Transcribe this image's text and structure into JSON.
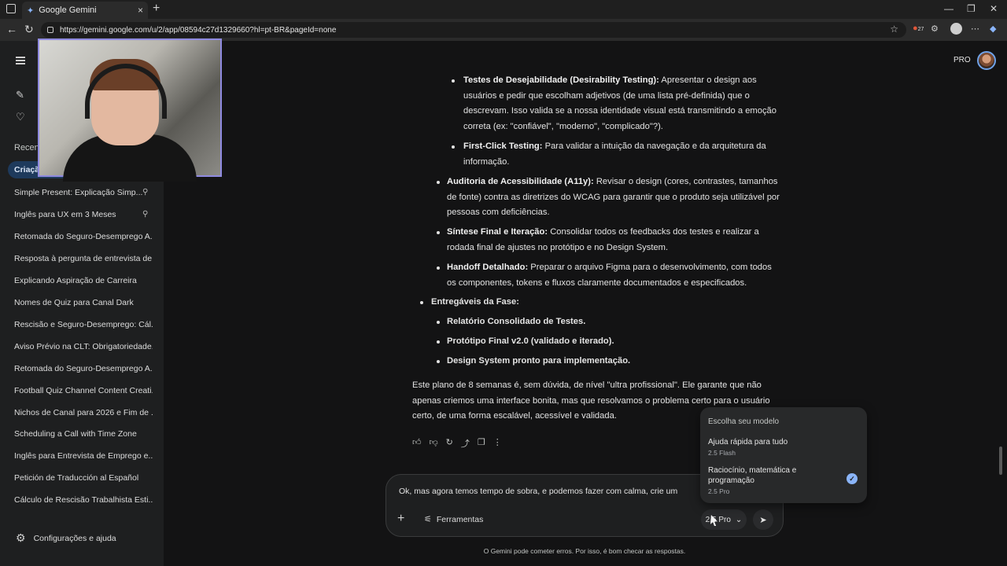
{
  "browser": {
    "tab_title": "Google Gemini",
    "url": "https://gemini.google.com/u/2/app/08594c27d1329660?hl=pt-BR&pageId=none",
    "ext_badge": "27"
  },
  "sidebar": {
    "recent_heading": "Recentes",
    "active_chat": "Criação",
    "items": [
      {
        "label": "Simple Present: Explicação Simp...",
        "pinned": true
      },
      {
        "label": "Inglês para UX em 3 Meses",
        "pinned": true
      },
      {
        "label": "Retomada do Seguro-Desemprego A..."
      },
      {
        "label": "Resposta à pergunta de entrevista de..."
      },
      {
        "label": "Explicando Aspiração de Carreira"
      },
      {
        "label": "Nomes de Quiz para Canal Dark"
      },
      {
        "label": "Rescisão e Seguro-Desemprego: Cál..."
      },
      {
        "label": "Aviso Prévio na CLT: Obrigatoriedade..."
      },
      {
        "label": "Retomada do Seguro-Desemprego A..."
      },
      {
        "label": "Football Quiz Channel Content Creati..."
      },
      {
        "label": "Nichos de Canal para 2026 e Fim de ..."
      },
      {
        "label": "Scheduling a Call with Time Zone"
      },
      {
        "label": "Inglês para Entrevista de Emprego e..."
      },
      {
        "label": "Petición de Traducción al Español"
      },
      {
        "label": "Cálculo de Rescisão Trabalhista Esti..."
      }
    ],
    "settings_label": "Configurações e ajuda"
  },
  "header": {
    "plan_badge": "PRO"
  },
  "response": {
    "l3_1_bold": "Testes de Desejabilidade (Desirability Testing):",
    "l3_1_text": " Apresentar o design aos usuários e pedir que escolham adjetivos (de uma lista pré-definida) que o descrevam. Isso valida se a nossa identidade visual está transmitindo a emoção correta (ex: \"confiável\", \"moderno\", \"complicado\"?).",
    "l3_2_bold": "First-Click Testing:",
    "l3_2_text": " Para validar a intuição da navegação e da arquitetura da informação.",
    "l2_1_bold": "Auditoria de Acessibilidade (A11y):",
    "l2_1_text": " Revisar o design (cores, contrastes, tamanhos de fonte) contra as diretrizes do WCAG para garantir que o produto seja utilizável por pessoas com deficiências.",
    "l2_2_bold": "Síntese Final e Iteração:",
    "l2_2_text": " Consolidar todos os feedbacks dos testes e realizar a rodada final de ajustes no protótipo e no Design System.",
    "l2_3_bold": "Handoff Detalhado:",
    "l2_3_text": " Preparar o arquivo Figma para o desenvolvimento, com todos os componentes, tokens e fluxos claramente documentados e especificados.",
    "deliverables_title": "Entregáveis da Fase:",
    "deliverables": [
      "Relatório Consolidado de Testes.",
      "Protótipo Final v2.0 (validado e iterado).",
      "Design System pronto para implementação."
    ],
    "closing": "Este plano de 8 semanas é, sem dúvida, de nível \"ultra profissional\". Ele garante que não apenas criemos uma interface bonita, mas que resolvamos o problema certo para o usuário certo, de uma forma escalável, acessível e validada."
  },
  "composer": {
    "value": "Ok, mas agora temos tempo de sobra, e podemos fazer com calma, crie um",
    "tools_label": "Ferramentas",
    "model_label": "2.5 Pro"
  },
  "model_menu": {
    "title": "Escolha seu modelo",
    "options": [
      {
        "main": "Ajuda rápida para tudo",
        "sub": "2.5 Flash",
        "selected": false
      },
      {
        "main": "Raciocínio, matemática e programação",
        "sub": "2.5 Pro",
        "selected": true
      }
    ]
  },
  "disclaimer": "O Gemini pode cometer erros. Por isso, é bom checar as respostas.",
  "icons": {
    "accent": "#8ab4f8",
    "sidebar_active_bg": "#1e3a5c"
  }
}
